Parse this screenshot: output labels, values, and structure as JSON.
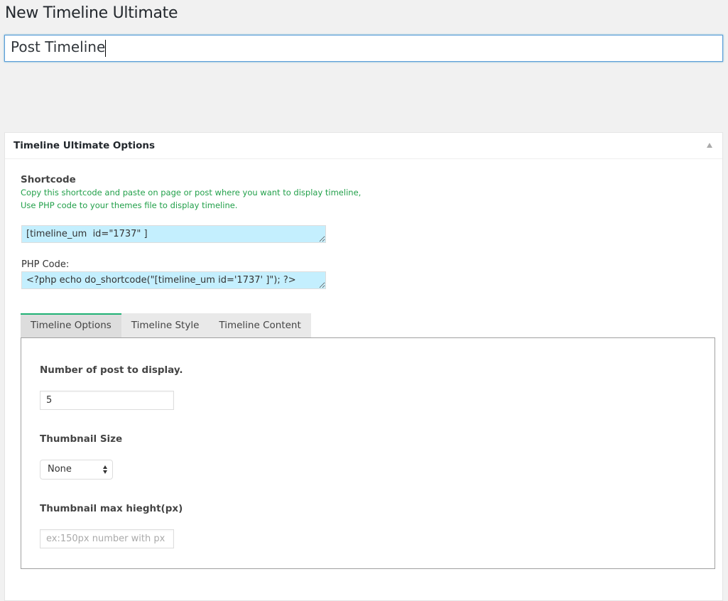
{
  "page": {
    "title": "New Timeline Ultimate",
    "title_input_value": "Post Timeline"
  },
  "metabox": {
    "title": "Timeline Ultimate Options",
    "toggle_icon": "triangle-up-icon",
    "shortcode": {
      "label": "Shortcode",
      "hint_line1": "Copy this shortcode and paste on page or post where you want to display timeline,",
      "hint_line2": "Use PHP code to your themes file to display timeline.",
      "value": "[timeline_um  id=\"1737\" ]"
    },
    "php_code": {
      "label": "PHP Code:",
      "value": "<?php echo do_shortcode(\"[timeline_um id='1737' ]\"); ?>"
    },
    "tabs": [
      {
        "label": "Timeline Options",
        "active": true
      },
      {
        "label": "Timeline Style",
        "active": false
      },
      {
        "label": "Timeline Content",
        "active": false
      }
    ],
    "options": {
      "post_count_label": "Number of post to display.",
      "post_count_value": "5",
      "thumb_size_label": "Thumbnail Size",
      "thumb_size_selected": "None",
      "thumb_max_height_label": "Thumbnail max hieght(px)",
      "thumb_max_height_value": "",
      "thumb_max_height_placeholder": "ex:150px number with px"
    }
  },
  "colors": {
    "accent_green": "#1fb174",
    "hint_green": "#22a04a",
    "code_bg": "#c4effe",
    "focus_blue": "#5b9dd9"
  }
}
